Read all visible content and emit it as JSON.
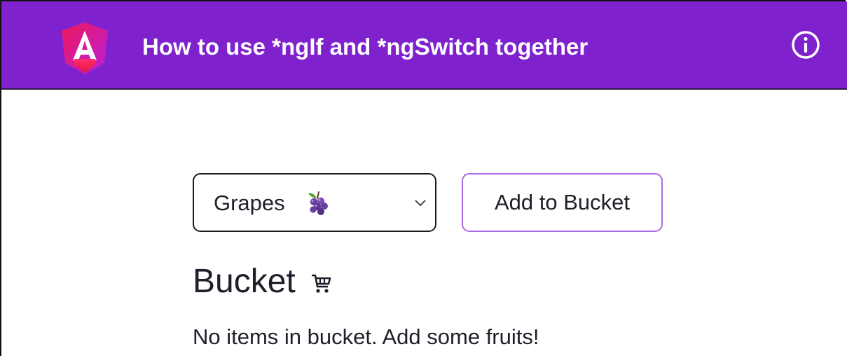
{
  "header": {
    "title": "How to use *ngIf and *ngSwitch together",
    "logo_icon": "angular-logo-icon",
    "info_icon": "info-icon",
    "background_color": "#7f22ce"
  },
  "fruit_select": {
    "selected_value": "Grapes",
    "selected_icon": "grape-icon",
    "dropdown_icon": "chevron-down-icon"
  },
  "add_button": {
    "label": "Add to Bucket",
    "border_color": "#a96ae3"
  },
  "bucket": {
    "heading": "Bucket",
    "heading_icon": "cart-icon",
    "empty_message": "No items in bucket. Add some fruits!"
  }
}
